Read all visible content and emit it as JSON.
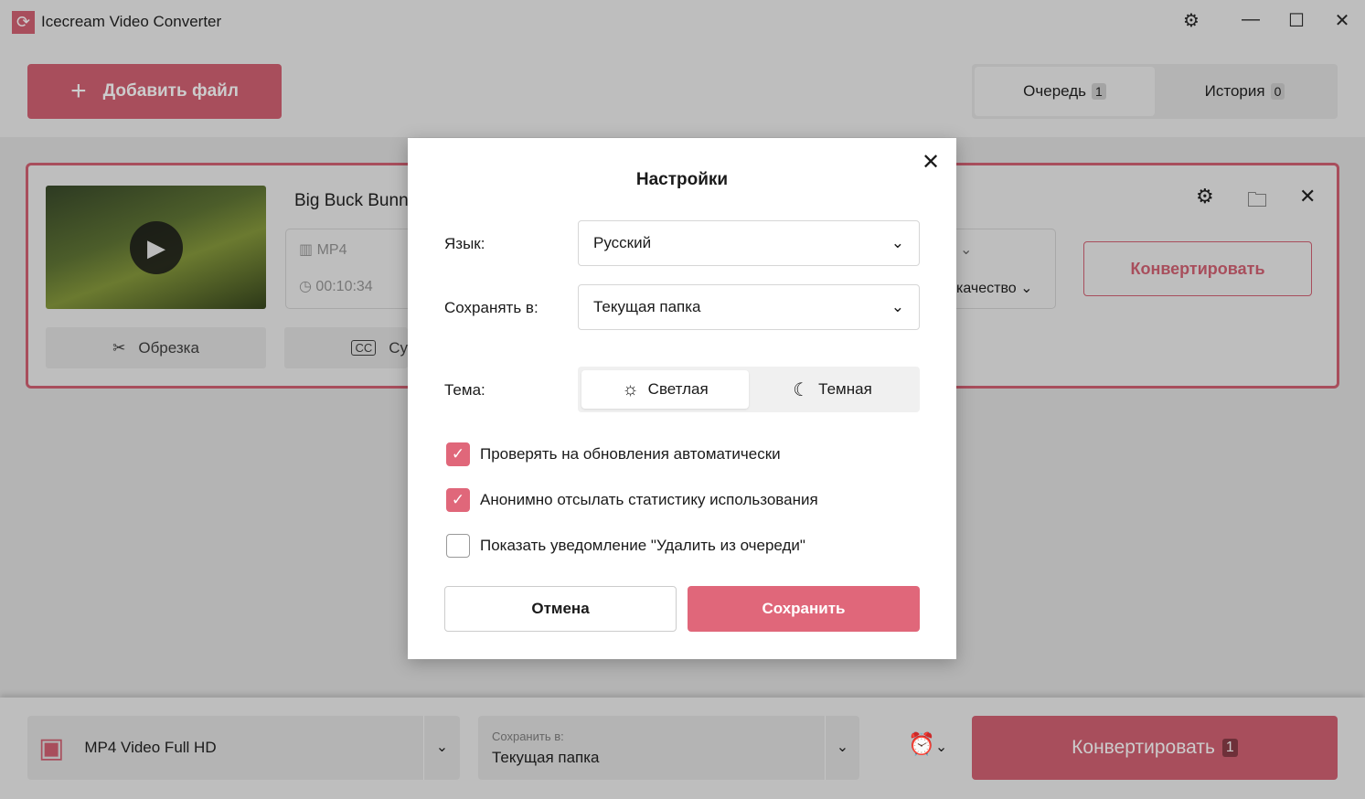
{
  "app": {
    "title": "Icecream Video Converter"
  },
  "header": {
    "add_file": "Добавить файл",
    "tabs": [
      {
        "label": "Очередь",
        "count": "1"
      },
      {
        "label": "История",
        "count": "0"
      }
    ]
  },
  "file": {
    "name": "Big Buck Bunny",
    "format": "MP4",
    "duration": "00:10:34",
    "trim": "Обрезка",
    "subtitles": "Су",
    "quality": "качество",
    "convert": "Конвертировать"
  },
  "bottom": {
    "preset": "MP4 Video Full HD",
    "save_label": "Сохранить в:",
    "save_value": "Текущая папка",
    "convert": "Конвертировать",
    "convert_count": "1"
  },
  "dialog": {
    "title": "Настройки",
    "language_label": "Язык:",
    "language_value": "Русский",
    "save_label": "Сохранять в:",
    "save_value": "Текущая папка",
    "theme_label": "Тема:",
    "theme_light": "Светлая",
    "theme_dark": "Темная",
    "checkboxes": [
      {
        "label": "Проверять на обновления автоматически",
        "checked": true
      },
      {
        "label": "Анонимно отсылать статистику использования",
        "checked": true
      },
      {
        "label": "Показать уведомление \"Удалить из очереди\"",
        "checked": false
      }
    ],
    "cancel": "Отмена",
    "save": "Сохранить"
  },
  "colors": {
    "accent": "#e0677a",
    "accent_dim": "#a84e5c"
  }
}
